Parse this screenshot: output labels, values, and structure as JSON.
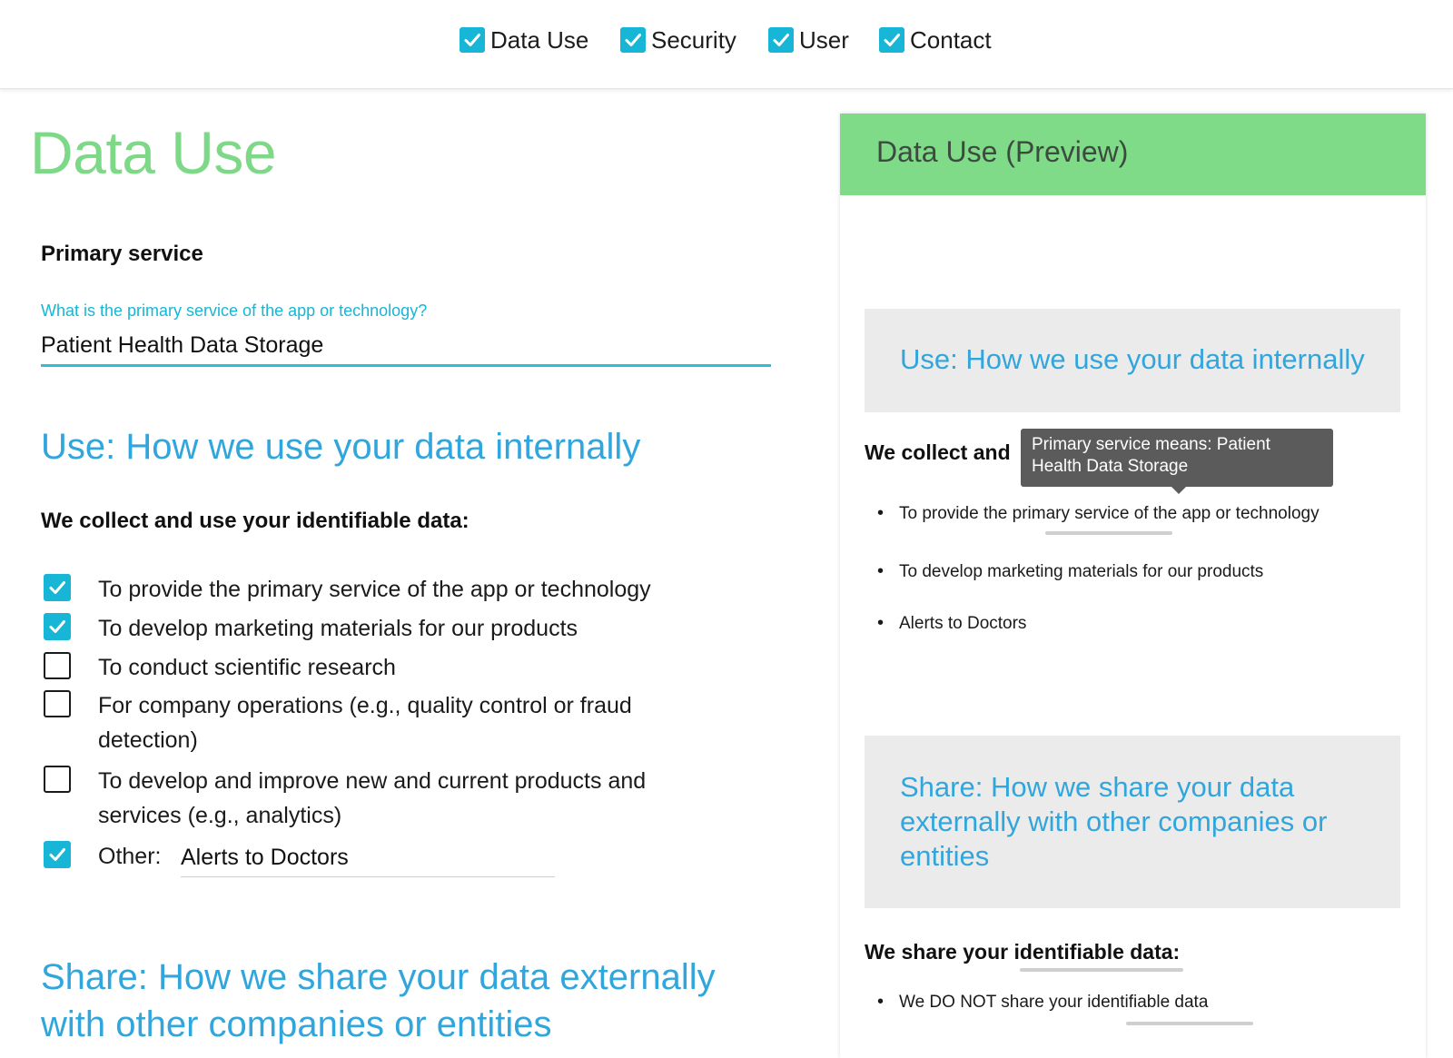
{
  "topnav": {
    "items": [
      {
        "label": "Data Use",
        "checked": true
      },
      {
        "label": "Security",
        "checked": true
      },
      {
        "label": "User",
        "checked": true
      },
      {
        "label": "Contact",
        "checked": true
      }
    ]
  },
  "form": {
    "title": "Data Use",
    "primary_service": {
      "label": "Primary service",
      "question": "What is the primary service of the app or technology?",
      "value": "Patient Health Data Storage"
    },
    "use_heading": "Use: How we use your data internally",
    "collect_label": "We collect and use your identifiable data:",
    "options": [
      {
        "label": "To provide the primary service of the app or technology",
        "checked": true
      },
      {
        "label": "To develop marketing materials for our products",
        "checked": true
      },
      {
        "label": "To conduct scientific research",
        "checked": false
      },
      {
        "label": "For company operations (e.g., quality control or fraud detection)",
        "checked": false
      },
      {
        "label": "To develop and improve new and current products and services (e.g., analytics)",
        "checked": false
      },
      {
        "label": "Other:",
        "checked": true
      }
    ],
    "other_value": "Alerts to Doctors",
    "share_heading": "Share: How we share your data externally with other companies or entities"
  },
  "preview": {
    "title": "Data Use (Preview)",
    "use_heading": "Use: How we use your data internally",
    "collect_label": "We collect and",
    "bullets": [
      "To provide the primary service of the app or technology",
      "To develop marketing materials for our products",
      "Alerts to Doctors"
    ],
    "share_heading": "Share: How we share your data externally with other companies or entities",
    "share_label": "We share your identifiable data:",
    "share_bullets": [
      "We DO NOT share your identifiable data"
    ],
    "tooltip": "Primary service means: Patient Health Data Storage"
  },
  "colors": {
    "accent_cyan": "#17b6d6",
    "title_green": "#7dd887",
    "header_green": "#7fdb87",
    "heading_blue": "#31a6dd",
    "box_grey": "#ebebeb"
  },
  "icons": {
    "checkbox_checked": "checkmark-icon",
    "bullet": "bullet-icon"
  }
}
